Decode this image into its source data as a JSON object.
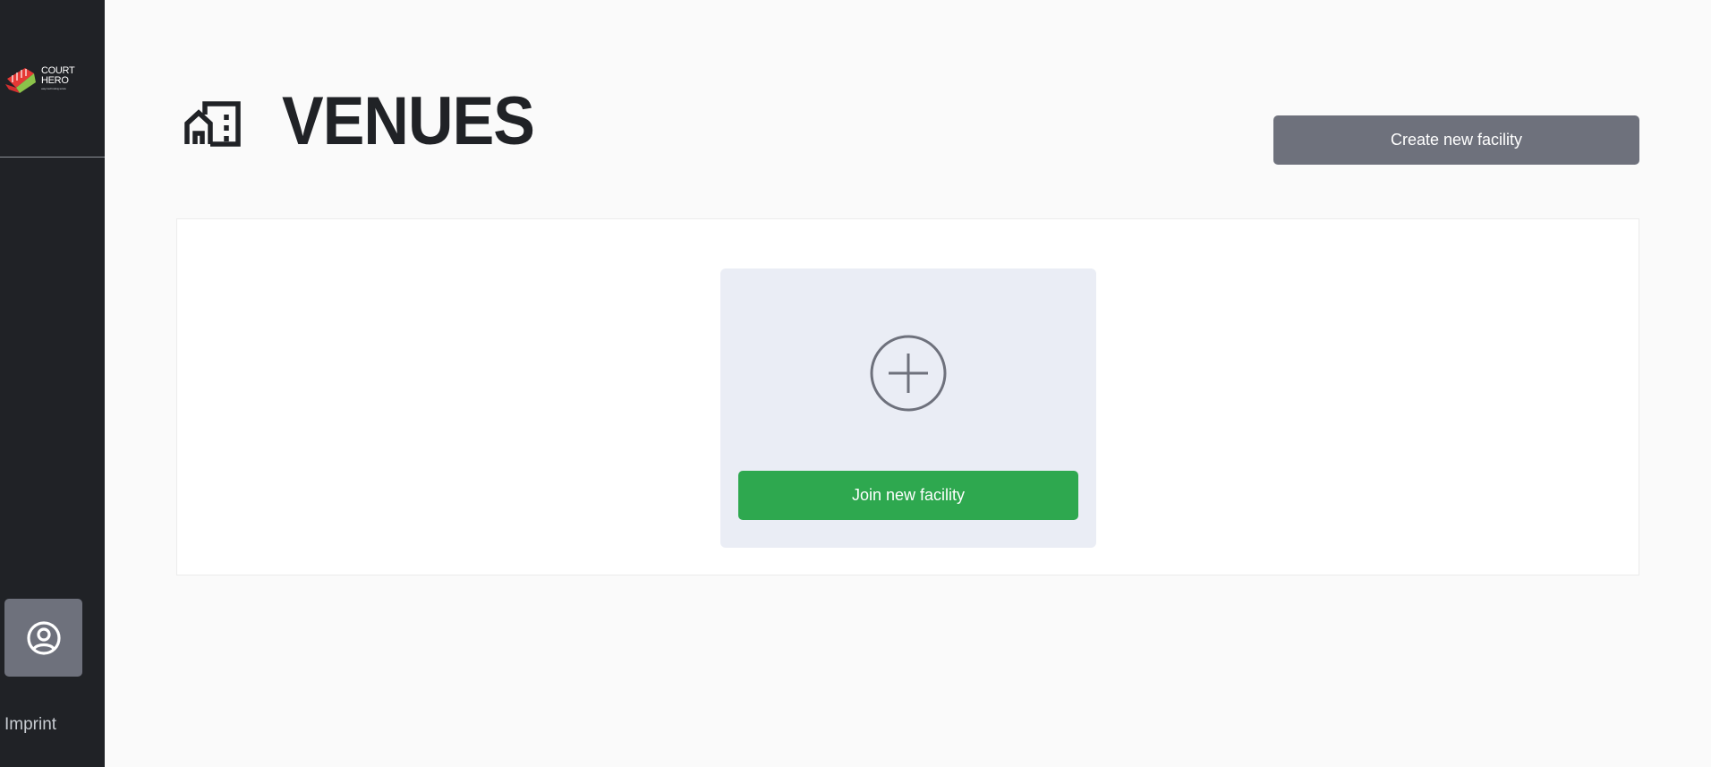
{
  "sidebar": {
    "logo": {
      "line1": "COURT",
      "line2": "HERO",
      "tagline": "easy court booking service"
    },
    "profile_icon": "user-circle-icon",
    "imprint_label": "Imprint"
  },
  "header": {
    "title": "VENUES",
    "title_icon": "building-icon",
    "create_button_label": "Create new facility"
  },
  "main": {
    "join_card": {
      "icon": "plus-circle-icon",
      "button_label": "Join new facility"
    }
  },
  "colors": {
    "sidebar_bg": "#202226",
    "page_bg": "#fafafa",
    "secondary_button": "#6e717c",
    "primary_button": "#2ea84f",
    "card_bg": "#eaedf5",
    "title": "#202226"
  }
}
